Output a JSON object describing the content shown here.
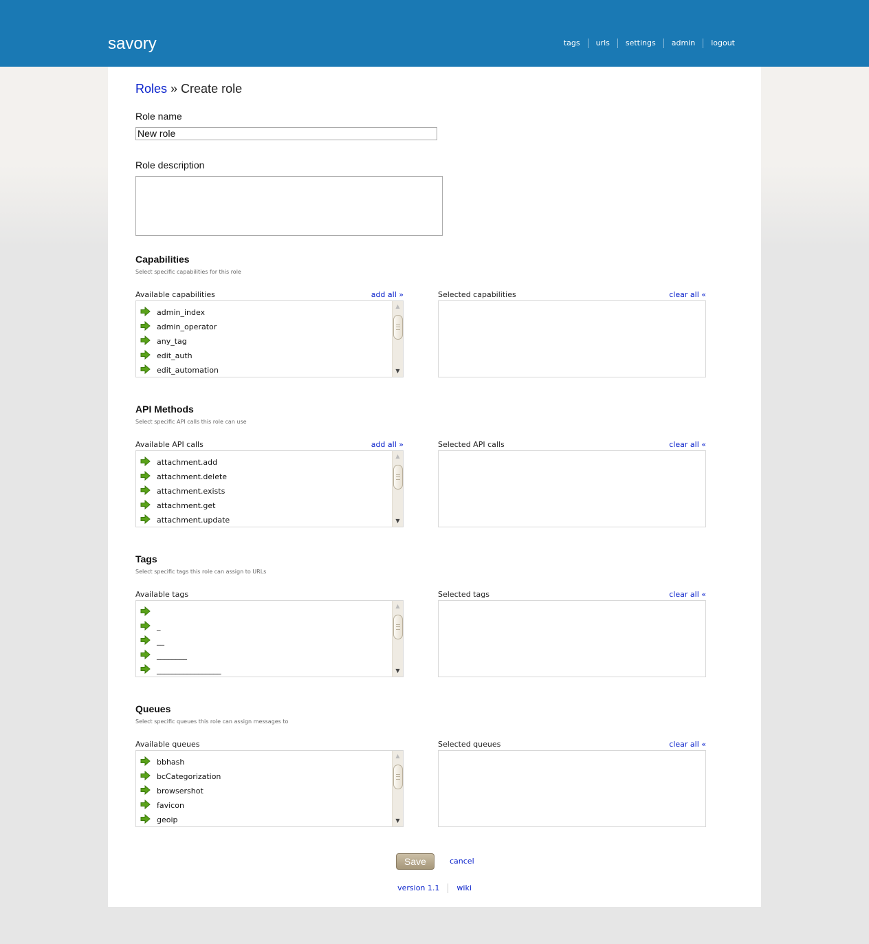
{
  "header": {
    "brand": "savory",
    "nav": [
      "tags",
      "urls",
      "settings",
      "admin",
      "logout"
    ]
  },
  "breadcrumb": {
    "parent": "Roles",
    "separator": " » ",
    "current": "Create role"
  },
  "form": {
    "role_name_label": "Role name",
    "role_name_value": "New role",
    "role_description_label": "Role description",
    "role_description_value": ""
  },
  "sections": [
    {
      "title": "Capabilities",
      "subtitle": "Select specific capabilities for this role",
      "available_label": "Available capabilities",
      "add_all": "add all »",
      "selected_label": "Selected capabilities",
      "clear_all": "clear all «",
      "items": [
        "admin_index",
        "admin_operator",
        "any_tag",
        "edit_auth",
        "edit_automation"
      ]
    },
    {
      "title": "API Methods",
      "subtitle": "Select specific API calls this role can use",
      "available_label": "Available API calls",
      "add_all": "add all »",
      "selected_label": "Selected API calls",
      "clear_all": "clear all «",
      "items": [
        "attachment.add",
        "attachment.delete",
        "attachment.exists",
        "attachment.get",
        "attachment.update"
      ]
    },
    {
      "title": "Tags",
      "subtitle": "Select specific tags this role can assign to URLs",
      "available_label": "Available tags",
      "add_all": "",
      "selected_label": "Selected tags",
      "clear_all": "clear all «",
      "items": [
        "",
        "_",
        "__",
        "________",
        "_________________"
      ]
    },
    {
      "title": "Queues",
      "subtitle": "Select specific queues this role can assign messages to",
      "available_label": "Available queues",
      "add_all": "",
      "selected_label": "Selected queues",
      "clear_all": "clear all «",
      "items": [
        "bbhash",
        "bcCategorization",
        "browsershot",
        "favicon",
        "geoip"
      ]
    }
  ],
  "actions": {
    "save": "Save",
    "cancel": "cancel"
  },
  "footer": {
    "version": "version 1.1",
    "wiki": "wiki"
  },
  "icons": {
    "add_item": "green-right-arrow-icon",
    "scroll_up": "▲",
    "scroll_down": "▼"
  },
  "colors": {
    "header_bg": "#1a79b4",
    "link": "#0a22cc",
    "arrow_green": "#5aa21a"
  }
}
